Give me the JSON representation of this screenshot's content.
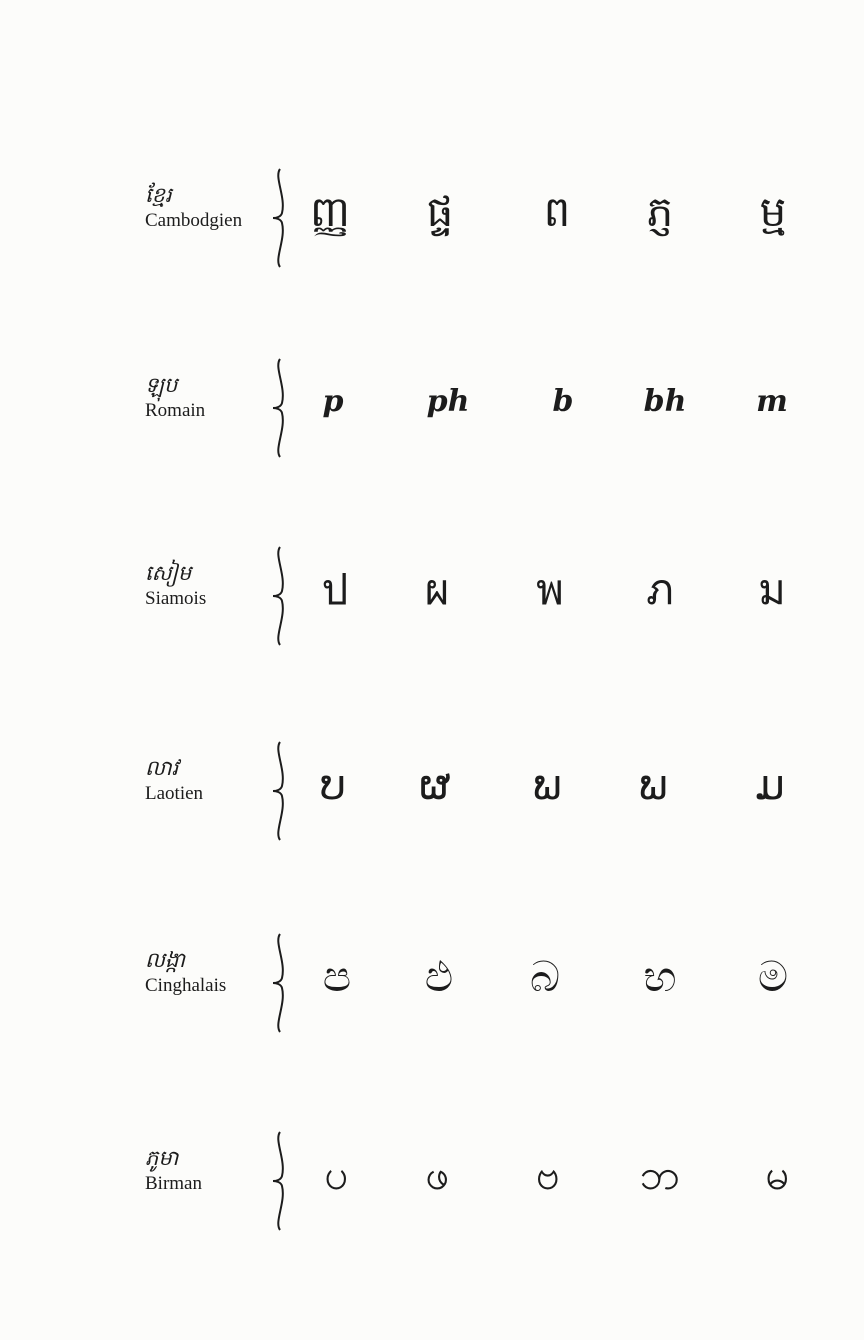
{
  "rows": [
    {
      "native_name": "ខ្មែរ",
      "french_name": "Cambodgien",
      "glyphs": [
        "ញ្ញ",
        "ផ្ទ",
        "ព",
        "ភ្ញ",
        "ម្ម"
      ]
    },
    {
      "native_name": "ឡុប",
      "french_name": "Romain",
      "glyphs": [
        "p",
        "ph",
        "b",
        "bh",
        "m"
      ]
    },
    {
      "native_name": "សៀម",
      "french_name": "Siamois",
      "glyphs": [
        "ป",
        "ผ",
        "พ",
        "ภ",
        "ม"
      ]
    },
    {
      "native_name": "លាវ",
      "french_name": "Laotien",
      "glyphs": [
        "ບ",
        "ຜ",
        "ພ",
        "ພ",
        "ມ"
      ]
    },
    {
      "native_name": "លង្កា",
      "french_name": "Cinghalais",
      "glyphs": [
        "ප",
        "ඵ",
        "බ",
        "භ",
        "ම"
      ]
    },
    {
      "native_name": "ភូមា",
      "french_name": "Birman",
      "glyphs": [
        "ပ",
        "ဖ",
        "ဗ",
        "ဘ",
        "မ"
      ]
    }
  ]
}
